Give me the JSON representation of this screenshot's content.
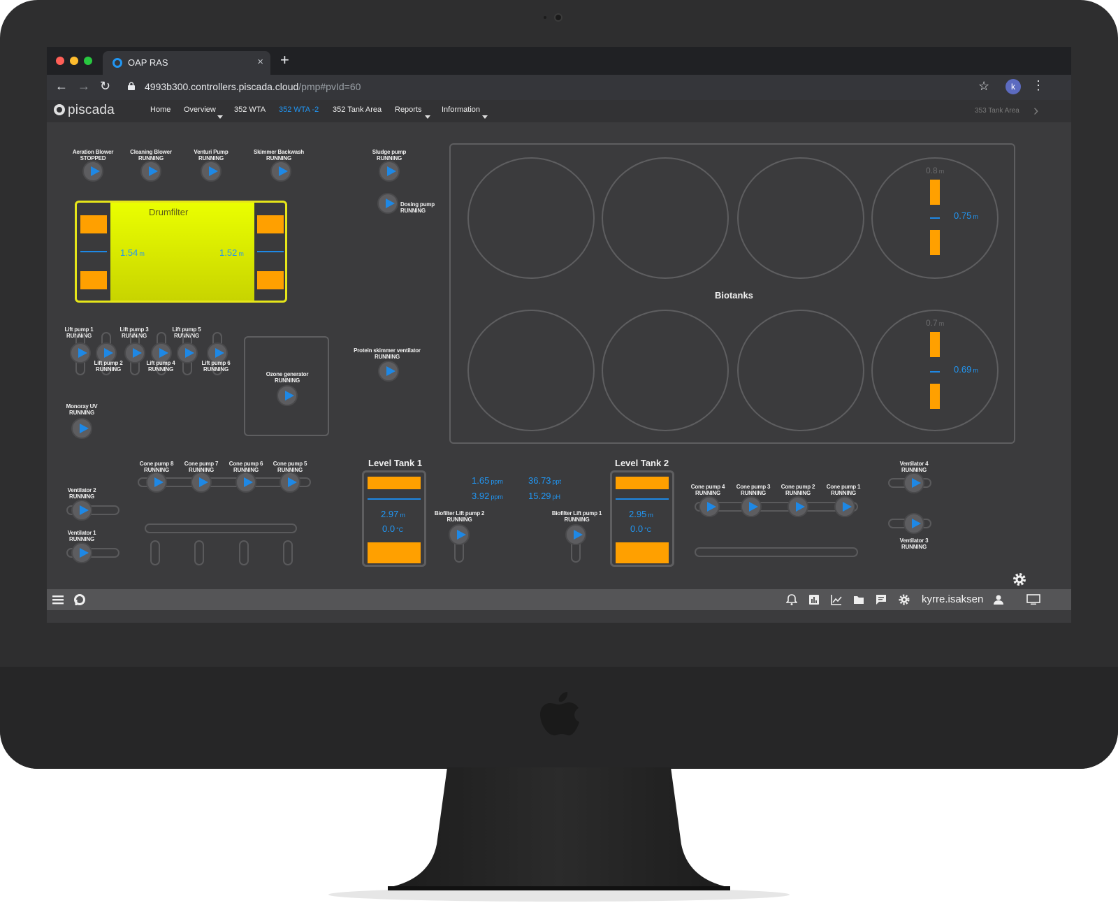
{
  "browser": {
    "tab_title": "OAP RAS",
    "tab_close": "×",
    "new_tab": "+",
    "url_host": "4993b300.controllers.piscada.cloud",
    "url_path": "/pmp#pvId=60",
    "back": "←",
    "forward": "→",
    "reload": "↻",
    "star": "☆",
    "avatar_letter": "k",
    "menu": "⋮"
  },
  "nav": {
    "logo": "piscada",
    "items": [
      {
        "label": "Home"
      },
      {
        "label": "Overview"
      },
      {
        "label": "352 WTA"
      },
      {
        "label": "352 WTA -2"
      },
      {
        "label": "352 Tank Area"
      },
      {
        "label": "Reports"
      },
      {
        "label": "Information"
      }
    ],
    "right_link": "353 Tank Area",
    "next": "›"
  },
  "equipment": {
    "aeration_blower": {
      "name": "Aeration Blower",
      "status": "STOPPED"
    },
    "cleaning_blower": {
      "name": "Cleaning Blower",
      "status": "RUNNING"
    },
    "venturi_pump": {
      "name": "Venturi Pump",
      "status": "RUNNING"
    },
    "skimmer_backwash": {
      "name": "Skimmer Backwash",
      "status": "RUNNING"
    },
    "sludge_pump": {
      "name": "Sludge pump",
      "status": "RUNNING"
    },
    "dosing_pump": {
      "name": "Dosing pump",
      "status": "RUNNING"
    },
    "lift_pump_1": {
      "name": "Lift pump 1",
      "status": "RUNNING"
    },
    "lift_pump_2": {
      "name": "Lift pump 2",
      "status": "RUNNING"
    },
    "lift_pump_3": {
      "name": "Lift pump 3",
      "status": "RUNNING"
    },
    "lift_pump_4": {
      "name": "Lift pump 4",
      "status": "RUNNING"
    },
    "lift_pump_5": {
      "name": "Lift pump 5",
      "status": "RUNNING"
    },
    "lift_pump_6": {
      "name": "Lift pump 6",
      "status": "RUNNING"
    },
    "monoray_uv": {
      "name": "Monoray  UV",
      "status": "RUNNING"
    },
    "ozone_generator": {
      "name": "Ozone generator",
      "status": "RUNNING"
    },
    "protein_skimmer_vent": {
      "name": "Protein skimmer ventilator",
      "status": "RUNNING"
    },
    "cone_pump_8": {
      "name": "Cone pump 8",
      "status": "RUNNING"
    },
    "cone_pump_7": {
      "name": "Cone pump 7",
      "status": "RUNNING"
    },
    "cone_pump_6": {
      "name": "Cone pump 6",
      "status": "RUNNING"
    },
    "cone_pump_5": {
      "name": "Cone pump 5",
      "status": "RUNNING"
    },
    "cone_pump_4": {
      "name": "Cone pump 4",
      "status": "RUNNING"
    },
    "cone_pump_3": {
      "name": "Cone pump 3",
      "status": "RUNNING"
    },
    "cone_pump_2": {
      "name": "Cone pump 2",
      "status": "RUNNING"
    },
    "cone_pump_1": {
      "name": "Cone pump 1",
      "status": "RUNNING"
    },
    "ventilator_1": {
      "name": "Ventilator 1",
      "status": "RUNNING"
    },
    "ventilator_2": {
      "name": "Ventilator 2",
      "status": "RUNNING"
    },
    "ventilator_3": {
      "name": "Ventilator 3",
      "status": "RUNNING"
    },
    "ventilator_4": {
      "name": "Ventilator 4",
      "status": "RUNNING"
    },
    "biofilter_lift_2": {
      "name": "Biofilter Lift pump 2",
      "status": "RUNNING"
    },
    "biofilter_lift_1": {
      "name": "Biofilter Lift pump 1",
      "status": "RUNNING"
    }
  },
  "drumfilter": {
    "title": "Drumfilter",
    "level_left": "1.54",
    "level_left_unit": "m",
    "level_right": "1.52",
    "level_right_unit": "m"
  },
  "biotanks": {
    "title": "Biotanks",
    "top_setpoint": "0.8",
    "top_setpoint_unit": "m",
    "top_level": "0.75",
    "top_level_unit": "m",
    "bottom_setpoint": "0.7",
    "bottom_setpoint_unit": "m",
    "bottom_level": "0.69",
    "bottom_level_unit": "m"
  },
  "level_tank_1": {
    "title": "Level Tank 1",
    "level": "2.97",
    "level_unit": "m",
    "temp": "0.0",
    "temp_unit": "°C"
  },
  "level_tank_2": {
    "title": "Level Tank 2",
    "level": "2.95",
    "level_unit": "m",
    "temp": "0.0",
    "temp_unit": "°C"
  },
  "water_quality": {
    "v1": "1.65",
    "v1_unit": "ppm",
    "v2": "3.92",
    "v2_unit": "ppm",
    "v3": "36.73",
    "v3_unit": "ppt",
    "v4": "15.29",
    "v4_unit": "pH"
  },
  "statusbar": {
    "user": "kyrre.isaksen"
  },
  "icons": [
    "hamburger-menu-icon",
    "piscada-icon",
    "bell-icon",
    "dashboard-icon",
    "chart-icon",
    "folder-icon",
    "message-icon",
    "gear-icon",
    "user-icon",
    "monitor-icon"
  ],
  "colors": {
    "accent": "#2196f3",
    "tank_fill": "#ffa000",
    "drumfilter": "#e6e61a",
    "background": "#3b3b3d"
  }
}
